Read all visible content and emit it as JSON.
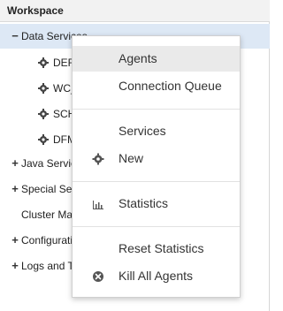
{
  "header": {
    "title": "Workspace"
  },
  "tree": {
    "data_services": {
      "expander": "−",
      "label": "Data Services"
    },
    "children": [
      {
        "label": "DEFA"
      },
      {
        "label": "WC_"
      },
      {
        "label": "SCH"
      },
      {
        "label": "DFM"
      }
    ],
    "java_services": {
      "expander": "+",
      "label": "Java Servic"
    },
    "special_services": {
      "expander": "+",
      "label": "Special Ser"
    },
    "cluster": {
      "label": "Cluster Ma"
    },
    "configuration": {
      "expander": "+",
      "label": "Configuratio"
    },
    "logs": {
      "expander": "+",
      "label": "Logs and T"
    }
  },
  "context_menu": {
    "agents": "Agents",
    "connection_queue": "Connection Queue",
    "services": "Services",
    "new": "New",
    "statistics": "Statistics",
    "reset_statistics": "Reset Statistics",
    "kill_all_agents": "Kill All Agents"
  },
  "icons": {
    "expand": "plus-icon",
    "collapse": "minus-icon",
    "service": "gear-icon",
    "new": "gear-icon",
    "statistics": "bar-chart-icon",
    "kill": "close-circle-icon"
  },
  "colors": {
    "header_bg": "#f2f2f2",
    "selected_row": "#dde8f5",
    "menu_highlight": "#eaeaea",
    "icon": "#555555"
  }
}
